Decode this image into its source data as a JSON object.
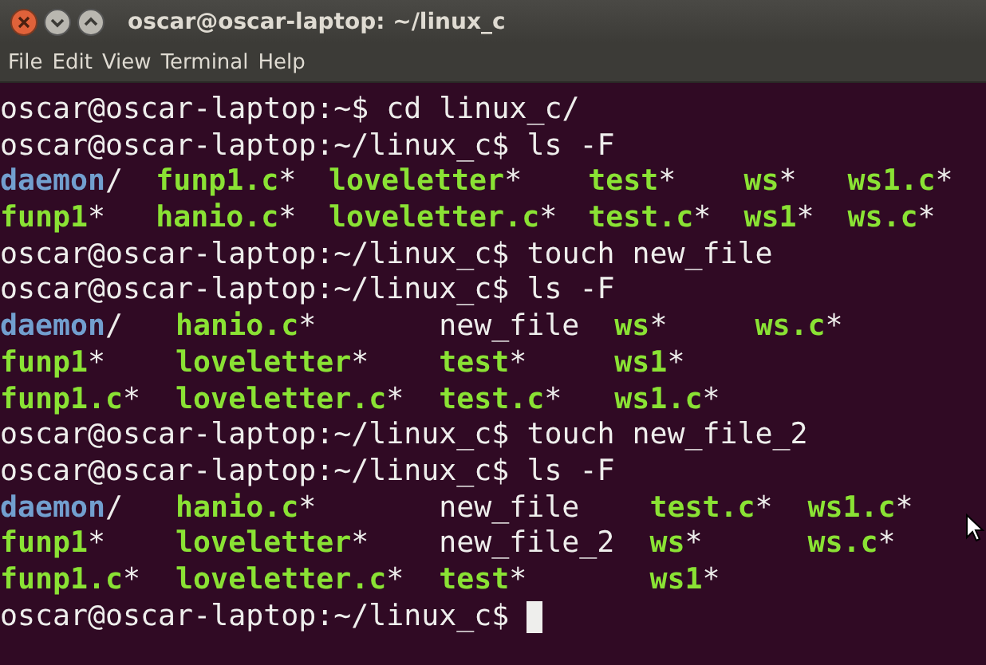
{
  "window": {
    "title": "oscar@oscar-laptop: ~/linux_c"
  },
  "menu": [
    "File",
    "Edit",
    "View",
    "Terminal",
    "Help"
  ],
  "lines": [
    {
      "kind": "prompt",
      "prompt": "oscar@oscar-laptop:~$",
      "command": "cd linux_c/"
    },
    {
      "kind": "prompt",
      "prompt": "oscar@oscar-laptop:~/linux_c$",
      "command": "ls -F"
    },
    {
      "kind": "listing",
      "rows": [
        [
          {
            "name": "daemon",
            "suffix": "/",
            "kind": "dir"
          },
          {
            "name": "funp1.c",
            "suffix": "*",
            "kind": "exec"
          },
          {
            "name": "loveletter",
            "suffix": "*",
            "kind": "exec"
          },
          {
            "name": "test",
            "suffix": "*",
            "kind": "exec"
          },
          {
            "name": "ws",
            "suffix": "*",
            "kind": "exec"
          },
          {
            "name": "ws1.c",
            "suffix": "*",
            "kind": "exec"
          }
        ],
        [
          {
            "name": "funp1",
            "suffix": "*",
            "kind": "exec"
          },
          {
            "name": "hanio.c",
            "suffix": "*",
            "kind": "exec"
          },
          {
            "name": "loveletter.c",
            "suffix": "*",
            "kind": "exec"
          },
          {
            "name": "test.c",
            "suffix": "*",
            "kind": "exec"
          },
          {
            "name": "ws1",
            "suffix": "*",
            "kind": "exec"
          },
          {
            "name": "ws.c",
            "suffix": "*",
            "kind": "exec"
          }
        ]
      ]
    },
    {
      "kind": "prompt",
      "prompt": "oscar@oscar-laptop:~/linux_c$",
      "command": "touch new_file"
    },
    {
      "kind": "prompt",
      "prompt": "oscar@oscar-laptop:~/linux_c$",
      "command": "ls -F"
    },
    {
      "kind": "listing",
      "rows": [
        [
          {
            "name": "daemon",
            "suffix": "/",
            "kind": "dir"
          },
          {
            "name": "hanio.c",
            "suffix": "*",
            "kind": "exec"
          },
          {
            "name": "new_file",
            "kind": "plain"
          },
          {
            "name": "ws",
            "suffix": "*",
            "kind": "exec"
          },
          {
            "name": "ws.c",
            "suffix": "*",
            "kind": "exec"
          }
        ],
        [
          {
            "name": "funp1",
            "suffix": "*",
            "kind": "exec"
          },
          {
            "name": "loveletter",
            "suffix": "*",
            "kind": "exec"
          },
          {
            "name": "test",
            "suffix": "*",
            "kind": "exec"
          },
          {
            "name": "ws1",
            "suffix": "*",
            "kind": "exec"
          }
        ],
        [
          {
            "name": "funp1.c",
            "suffix": "*",
            "kind": "exec"
          },
          {
            "name": "loveletter.c",
            "suffix": "*",
            "kind": "exec"
          },
          {
            "name": "test.c",
            "suffix": "*",
            "kind": "exec"
          },
          {
            "name": "ws1.c",
            "suffix": "*",
            "kind": "exec"
          }
        ]
      ]
    },
    {
      "kind": "prompt",
      "prompt": "oscar@oscar-laptop:~/linux_c$",
      "command": "touch new_file_2"
    },
    {
      "kind": "prompt",
      "prompt": "oscar@oscar-laptop:~/linux_c$",
      "command": "ls -F"
    },
    {
      "kind": "listing",
      "rows": [
        [
          {
            "name": "daemon",
            "suffix": "/",
            "kind": "dir"
          },
          {
            "name": "hanio.c",
            "suffix": "*",
            "kind": "exec"
          },
          {
            "name": "new_file",
            "kind": "plain"
          },
          {
            "name": "test.c",
            "suffix": "*",
            "kind": "exec"
          },
          {
            "name": "ws1.c",
            "suffix": "*",
            "kind": "exec"
          }
        ],
        [
          {
            "name": "funp1",
            "suffix": "*",
            "kind": "exec"
          },
          {
            "name": "loveletter",
            "suffix": "*",
            "kind": "exec"
          },
          {
            "name": "new_file_2",
            "kind": "plain"
          },
          {
            "name": "ws",
            "suffix": "*",
            "kind": "exec"
          },
          {
            "name": "ws.c",
            "suffix": "*",
            "kind": "exec"
          }
        ],
        [
          {
            "name": "funp1.c",
            "suffix": "*",
            "kind": "exec"
          },
          {
            "name": "loveletter.c",
            "suffix": "*",
            "kind": "exec"
          },
          {
            "name": "test",
            "suffix": "*",
            "kind": "exec"
          },
          {
            "name": "ws1",
            "suffix": "*",
            "kind": "exec"
          }
        ]
      ]
    },
    {
      "kind": "prompt",
      "prompt": "oscar@oscar-laptop:~/linux_c$",
      "cursor": true
    }
  ]
}
